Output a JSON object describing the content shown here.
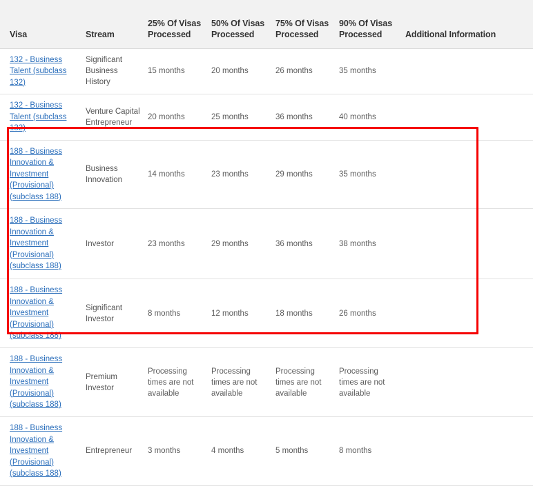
{
  "table": {
    "columns": [
      {
        "key": "visa",
        "label": "Visa"
      },
      {
        "key": "stream",
        "label": "Stream"
      },
      {
        "key": "p25",
        "label": "25% Of Visas Processed"
      },
      {
        "key": "p50",
        "label": "50% Of Visas Processed"
      },
      {
        "key": "p75",
        "label": "75% Of Visas Processed"
      },
      {
        "key": "p90",
        "label": "90% Of Visas Processed"
      },
      {
        "key": "additional",
        "label": "Additional Information"
      }
    ],
    "header": {
      "visa": "Visa",
      "stream": "Stream",
      "p25_line1": "25% Of Visas",
      "p25_line2": "Processed",
      "p50_line1": "50% Of Visas",
      "p50_line2": "Processed",
      "p75_line1": "75% Of Visas",
      "p75_line2": "Processed",
      "p90_line1": "90% Of Visas",
      "p90_line2": "Processed",
      "additional": "Additional Information"
    },
    "rows": [
      {
        "visa_link": "132 - Business Talent (subclass 132)",
        "stream": "Significant Business History",
        "p25": "15 months",
        "p50": "20 months",
        "p75": "26 months",
        "p90": "35 months",
        "additional": ""
      },
      {
        "visa_link": "132 - Business Talent (subclass 132)",
        "stream": "Venture Capital Entrepreneur",
        "p25": "20 months",
        "p50": "25 months",
        "p75": "36 months",
        "p90": "40 months",
        "additional": ""
      },
      {
        "visa_link": "188 - Business Innovation & Investment (Provisional) (subclass 188)",
        "stream": "Business Innovation",
        "p25": "14 months",
        "p50": "23 months",
        "p75": "29 months",
        "p90": "35 months",
        "additional": ""
      },
      {
        "visa_link": "188 - Business Innovation & Investment (Provisional) (subclass 188)",
        "stream": "Investor",
        "p25": "23 months",
        "p50": "29 months",
        "p75": "36 months",
        "p90": "38 months",
        "additional": ""
      },
      {
        "visa_link": "188 - Business Innovation & Investment (Provisional) (subclass 188)",
        "stream": "Significant Investor",
        "p25": "8 months",
        "p50": "12 months",
        "p75": "18 months",
        "p90": "26 months",
        "additional": ""
      },
      {
        "visa_link": "188 - Business Innovation & Investment (Provisional) (subclass 188)",
        "stream": "Premium Investor",
        "p25": "Processing times are not available",
        "p50": "Processing times are not available",
        "p75": "Processing times are not available",
        "p90": "Processing times are not available",
        "additional": ""
      },
      {
        "visa_link": "188 - Business Innovation & Investment (Provisional) (subclass 188)",
        "stream": "Entrepreneur",
        "p25": "3 months",
        "p50": "4 months",
        "p75": "5 months",
        "p90": "8 months",
        "additional": ""
      }
    ]
  },
  "annotation": {
    "highlight_color": "#f50000",
    "highlight_rows": [
      3,
      4,
      5
    ]
  },
  "colors": {
    "link": "#2a6ebb",
    "header_bg": "#f2f2f2",
    "header_text": "#333333",
    "body_text": "#5c5c5c",
    "row_divider": "#e2e2e2",
    "highlight": "#f50000"
  }
}
